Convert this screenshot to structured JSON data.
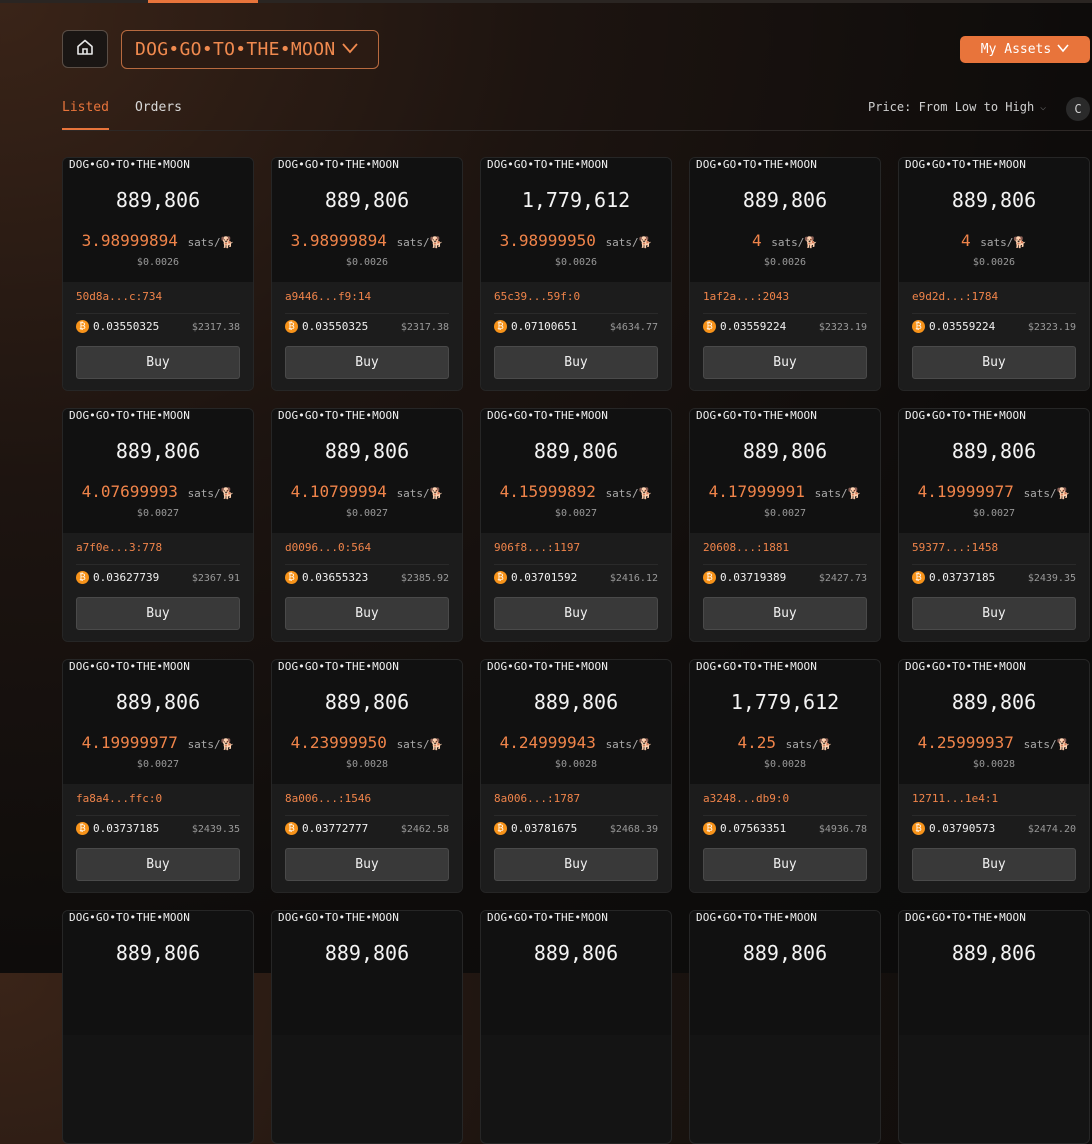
{
  "header": {
    "collection_name": "DOG•GO•TO•THE•MOON",
    "my_assets_label": "My Assets"
  },
  "tabs": [
    {
      "label": "Listed",
      "active": true
    },
    {
      "label": "Orders",
      "active": false
    }
  ],
  "sort": {
    "label": "Price: From Low to High"
  },
  "colors": {
    "accent": "#e8743b",
    "price": "#f0844a",
    "btc": "#f7931a"
  },
  "icons": {
    "home": "home-icon",
    "chevron": "chevron-down-icon",
    "refresh": "refresh-icon",
    "coin": "bitcoin-icon",
    "dog": "dog-icon"
  },
  "cards": [
    {
      "name": "DOG•GO•TO•THE•MOON",
      "amount": "889,806",
      "price": "3.98999894",
      "unit": "sats/",
      "usd": "$0.0026",
      "id": "50d8a...c:734",
      "btc": "0.03550325",
      "total_usd": "$2317.38",
      "buy": "Buy"
    },
    {
      "name": "DOG•GO•TO•THE•MOON",
      "amount": "889,806",
      "price": "3.98999894",
      "unit": "sats/",
      "usd": "$0.0026",
      "id": "a9446...f9:14",
      "btc": "0.03550325",
      "total_usd": "$2317.38",
      "buy": "Buy"
    },
    {
      "name": "DOG•GO•TO•THE•MOON",
      "amount": "1,779,612",
      "price": "3.98999950",
      "unit": "sats/",
      "usd": "$0.0026",
      "id": "65c39...59f:0",
      "btc": "0.07100651",
      "total_usd": "$4634.77",
      "buy": "Buy"
    },
    {
      "name": "DOG•GO•TO•THE•MOON",
      "amount": "889,806",
      "price": "4",
      "unit": "sats/",
      "usd": "$0.0026",
      "id": "1af2a...:2043",
      "btc": "0.03559224",
      "total_usd": "$2323.19",
      "buy": "Buy"
    },
    {
      "name": "DOG•GO•TO•THE•MOON",
      "amount": "889,806",
      "price": "4",
      "unit": "sats/",
      "usd": "$0.0026",
      "id": "e9d2d...:1784",
      "btc": "0.03559224",
      "total_usd": "$2323.19",
      "buy": "Buy"
    },
    {
      "name": "DOG•GO•TO•THE•MOON",
      "amount": "889,806",
      "price": "4.07699993",
      "unit": "sats/",
      "usd": "$0.0027",
      "id": "a7f0e...3:778",
      "btc": "0.03627739",
      "total_usd": "$2367.91",
      "buy": "Buy"
    },
    {
      "name": "DOG•GO•TO•THE•MOON",
      "amount": "889,806",
      "price": "4.10799994",
      "unit": "sats/",
      "usd": "$0.0027",
      "id": "d0096...0:564",
      "btc": "0.03655323",
      "total_usd": "$2385.92",
      "buy": "Buy"
    },
    {
      "name": "DOG•GO•TO•THE•MOON",
      "amount": "889,806",
      "price": "4.15999892",
      "unit": "sats/",
      "usd": "$0.0027",
      "id": "906f8...:1197",
      "btc": "0.03701592",
      "total_usd": "$2416.12",
      "buy": "Buy"
    },
    {
      "name": "DOG•GO•TO•THE•MOON",
      "amount": "889,806",
      "price": "4.17999991",
      "unit": "sats/",
      "usd": "$0.0027",
      "id": "20608...:1881",
      "btc": "0.03719389",
      "total_usd": "$2427.73",
      "buy": "Buy"
    },
    {
      "name": "DOG•GO•TO•THE•MOON",
      "amount": "889,806",
      "price": "4.19999977",
      "unit": "sats/",
      "usd": "$0.0027",
      "id": "59377...:1458",
      "btc": "0.03737185",
      "total_usd": "$2439.35",
      "buy": "Buy"
    },
    {
      "name": "DOG•GO•TO•THE•MOON",
      "amount": "889,806",
      "price": "4.19999977",
      "unit": "sats/",
      "usd": "$0.0027",
      "id": "fa8a4...ffc:0",
      "btc": "0.03737185",
      "total_usd": "$2439.35",
      "buy": "Buy"
    },
    {
      "name": "DOG•GO•TO•THE•MOON",
      "amount": "889,806",
      "price": "4.23999950",
      "unit": "sats/",
      "usd": "$0.0028",
      "id": "8a006...:1546",
      "btc": "0.03772777",
      "total_usd": "$2462.58",
      "buy": "Buy"
    },
    {
      "name": "DOG•GO•TO•THE•MOON",
      "amount": "889,806",
      "price": "4.24999943",
      "unit": "sats/",
      "usd": "$0.0028",
      "id": "8a006...:1787",
      "btc": "0.03781675",
      "total_usd": "$2468.39",
      "buy": "Buy"
    },
    {
      "name": "DOG•GO•TO•THE•MOON",
      "amount": "1,779,612",
      "price": "4.25",
      "unit": "sats/",
      "usd": "$0.0028",
      "id": "a3248...db9:0",
      "btc": "0.07563351",
      "total_usd": "$4936.78",
      "buy": "Buy"
    },
    {
      "name": "DOG•GO•TO•THE•MOON",
      "amount": "889,806",
      "price": "4.25999937",
      "unit": "sats/",
      "usd": "$0.0028",
      "id": "12711...1e4:1",
      "btc": "0.03790573",
      "total_usd": "$2474.20",
      "buy": "Buy"
    },
    {
      "name": "DOG•GO•TO•THE•MOON",
      "amount": "889,806"
    },
    {
      "name": "DOG•GO•TO•THE•MOON",
      "amount": "889,806"
    },
    {
      "name": "DOG•GO•TO•THE•MOON",
      "amount": "889,806"
    },
    {
      "name": "DOG•GO•TO•THE•MOON",
      "amount": "889,806"
    },
    {
      "name": "DOG•GO•TO•THE•MOON",
      "amount": "889,806"
    }
  ]
}
